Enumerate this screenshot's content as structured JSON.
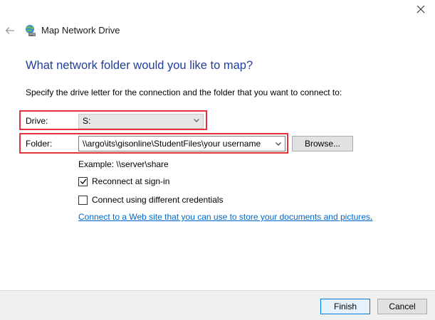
{
  "window": {
    "title": "Map Network Drive",
    "close_icon": "close-icon",
    "back_icon": "back-arrow-icon",
    "app_icon": "network-drive-icon"
  },
  "page": {
    "heading": "What network folder would you like to map?",
    "instructions": "Specify the drive letter for the connection and the folder that you want to connect to:"
  },
  "drive": {
    "label": "Drive:",
    "value": "S:"
  },
  "folder": {
    "label": "Folder:",
    "value": "\\\\argo\\its\\gisonline\\StudentFiles\\your username",
    "browse_label": "Browse..."
  },
  "example": "Example: \\\\server\\share",
  "options": {
    "reconnect": {
      "label": "Reconnect at sign-in",
      "checked": true
    },
    "different_credentials": {
      "label": "Connect using different credentials",
      "checked": false
    }
  },
  "link": {
    "text": "Connect to a Web site that you can use to store your documents and pictures",
    "suffix": "."
  },
  "footer": {
    "finish_label": "Finish",
    "cancel_label": "Cancel"
  },
  "colors": {
    "heading": "#1f3f99",
    "highlight": "#e0333a",
    "link": "#0066cc",
    "accent": "#0078d7"
  }
}
